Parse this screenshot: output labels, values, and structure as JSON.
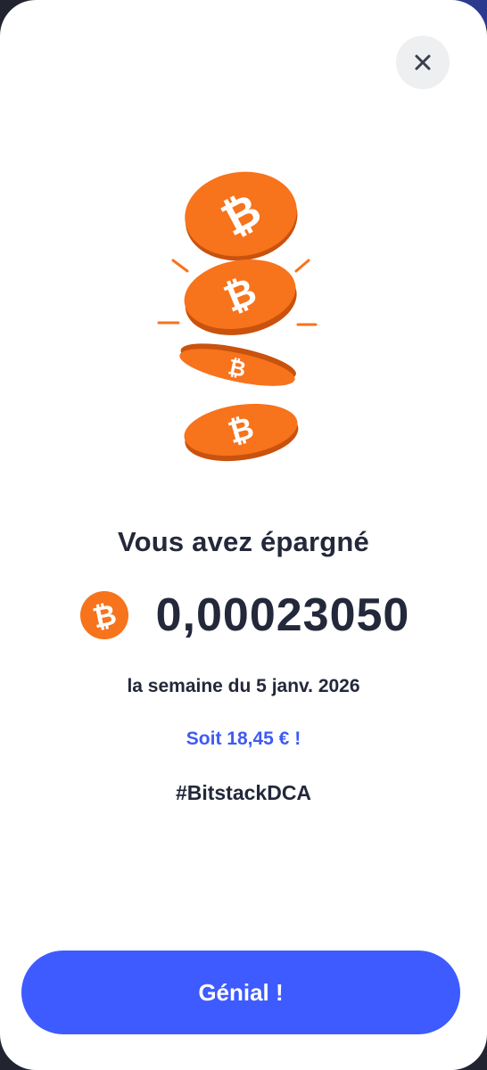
{
  "modal": {
    "close_icon": "close-icon",
    "illustration_icon": "falling-bitcoin-coins-icon",
    "title": "Vous avez épargné",
    "currency_icon": "bitcoin-icon",
    "amount": "0,00023050",
    "period": "la semaine du 5 janv. 2026",
    "fiat_value": "Soit 18,45 € !",
    "hashtag": "#BitstackDCA",
    "cta_label": "Génial !"
  },
  "colors": {
    "accent": "#3d5bff",
    "fiat_text": "#3f5bf2",
    "bitcoin_orange": "#f7731c",
    "text_dark": "#23283a"
  }
}
